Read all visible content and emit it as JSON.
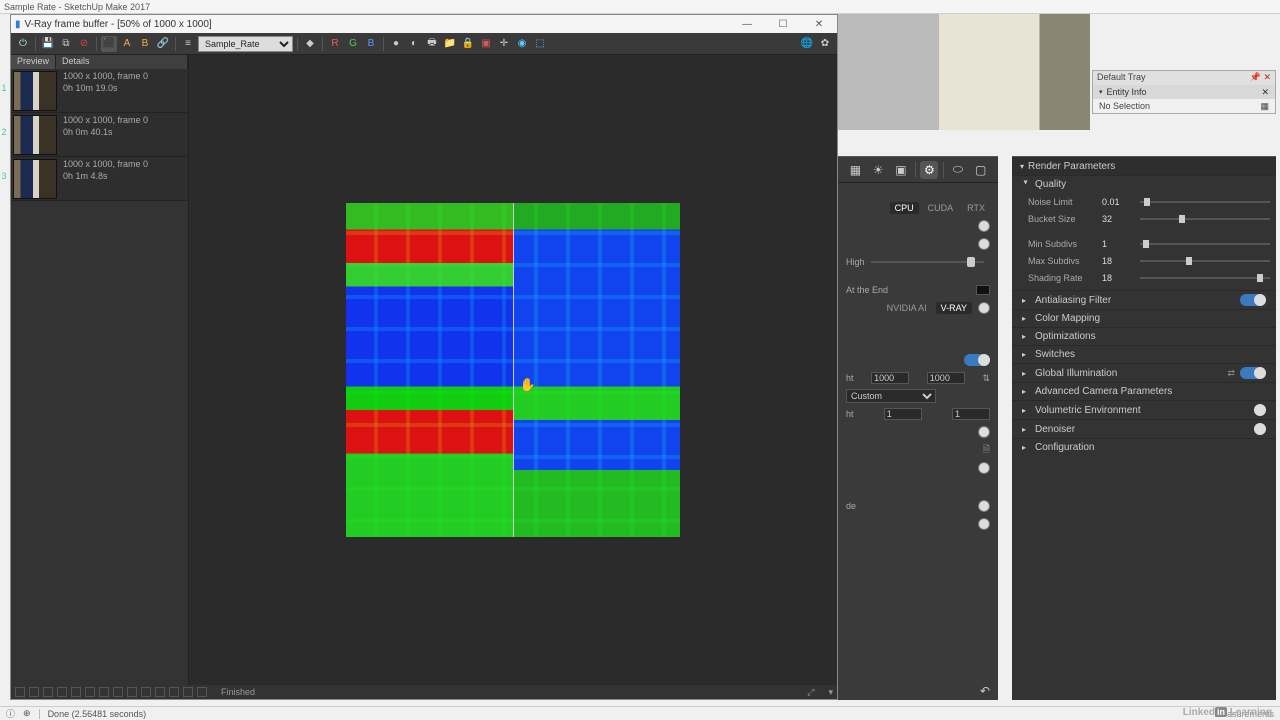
{
  "app": {
    "title": "Sample Rate - SketchUp Make 2017"
  },
  "vfb": {
    "title": "V-Ray frame buffer - [50% of 1000 x 1000]",
    "win": {
      "min": "—",
      "max": "☐",
      "close": "✕"
    },
    "channel": "Sample_Rate",
    "sidebar": {
      "tab_preview": "Preview",
      "tab_details": "Details",
      "items": [
        {
          "idx": "1",
          "line1": "1000 x 1000, frame 0",
          "line2": "0h 10m 19.0s"
        },
        {
          "idx": "2",
          "line1": "1000 x 1000, frame 0",
          "line2": "0h 0m 40.1s"
        },
        {
          "idx": "3",
          "line1": "1000 x 1000, frame 0",
          "line2": "0h 1m 4.8s"
        }
      ]
    },
    "status": {
      "text": "Finished"
    }
  },
  "tray": {
    "title": "Default Tray",
    "section": "Entity Info",
    "body": "No Selection"
  },
  "ae": {
    "engines": {
      "a": "CPU",
      "b": "CUDA",
      "c": "RTX"
    },
    "quality": {
      "label": "High"
    },
    "denoise_at": {
      "label": "At the End"
    },
    "denoise_engine": {
      "a": "NVIDIA AI",
      "b": "V-RAY"
    },
    "size": {
      "w": "1000",
      "h": "1000",
      "label": "ht"
    },
    "preset": {
      "value": "Custom"
    },
    "ratio": {
      "label": "ht",
      "a": "1",
      "b": "1"
    },
    "mode": {
      "label": "de"
    }
  },
  "rp": {
    "header": "Render Parameters",
    "quality": {
      "title": "Quality",
      "noise_limit": {
        "label": "Noise Limit",
        "value": "0.01"
      },
      "bucket_size": {
        "label": "Bucket Size",
        "value": "32"
      },
      "min_subdivs": {
        "label": "Min Subdivs",
        "value": "1"
      },
      "max_subdivs": {
        "label": "Max Subdivs",
        "value": "18"
      },
      "shading_rate": {
        "label": "Shading Rate",
        "value": "18"
      }
    },
    "sections": {
      "aa": "Antialiasing Filter",
      "cm": "Color Mapping",
      "opt": "Optimizations",
      "sw": "Switches",
      "gi": "Global Illumination",
      "acp": "Advanced Camera Parameters",
      "ve": "Volumetric Environment",
      "dn": "Denoiser",
      "cfg": "Configuration"
    }
  },
  "status": {
    "text": "Done (2.56481 seconds)"
  },
  "brand": {
    "a": "Linked",
    "b": "in",
    "c": " Learning"
  }
}
